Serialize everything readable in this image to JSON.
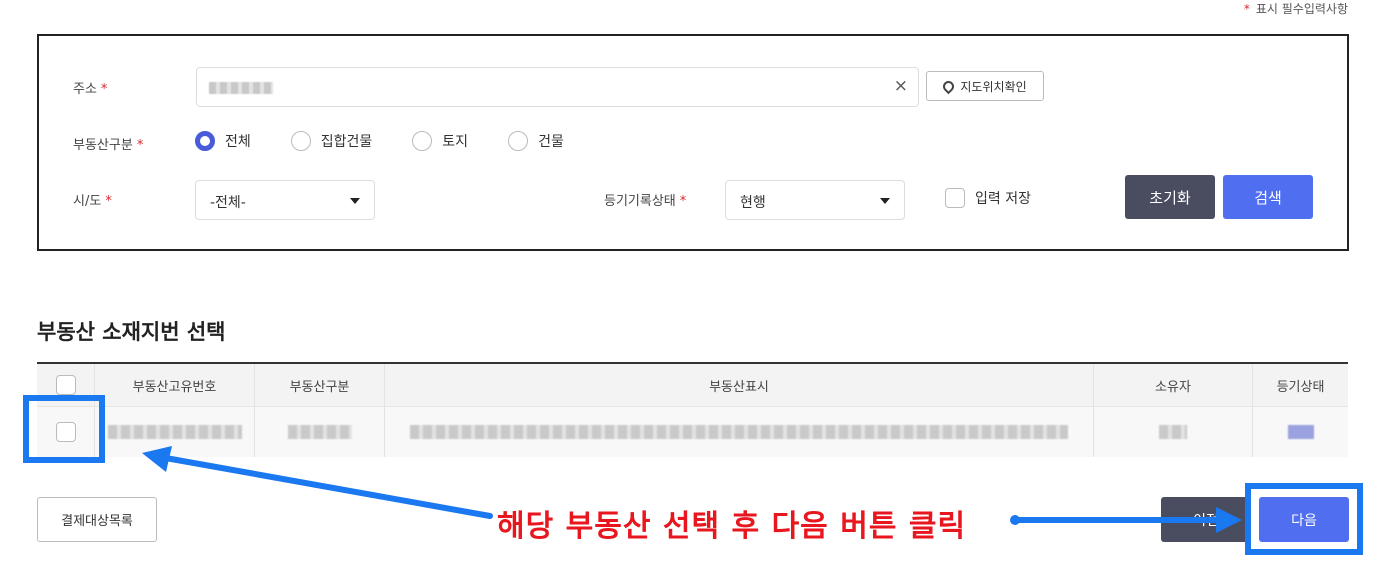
{
  "required_note": {
    "star": "*",
    "text": "표시 필수입력사항"
  },
  "search": {
    "address_label": "주소",
    "address_clear": "×",
    "map_button": "지도위치확인",
    "type_label": "부동산구분",
    "type_options": [
      {
        "label": "전체",
        "selected": true
      },
      {
        "label": "집합건물",
        "selected": false
      },
      {
        "label": "토지",
        "selected": false
      },
      {
        "label": "건물",
        "selected": false
      }
    ],
    "sido_label": "시/도",
    "sido_value": "-전체-",
    "status_label": "등기기록상태",
    "status_value": "현행",
    "save_label": "입력 저장",
    "reset_button": "초기화",
    "search_button": "검색",
    "required_star": "*"
  },
  "section_title": "부동산 소재지번 선택",
  "table": {
    "headers": [
      "부동산고유번호",
      "부동산구분",
      "부동산표시",
      "소유자",
      "등기상태"
    ]
  },
  "footer": {
    "list_button": "결제대상목록",
    "prev_button": "이전",
    "next_button": "다음"
  },
  "instruction": "해당 부동산 선택 후 다음 버튼 클릭",
  "colors": {
    "accent": "#4f6ef0",
    "highlight": "#1a78f0",
    "instruction": "#e8161e",
    "dark_button": "#4a4d5f"
  }
}
